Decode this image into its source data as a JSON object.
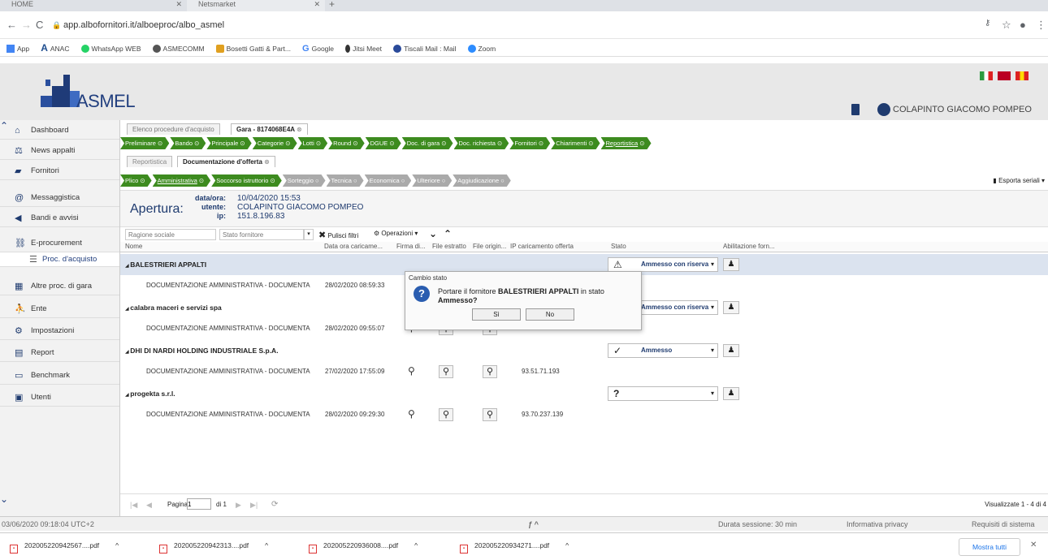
{
  "browser": {
    "tabs": [
      {
        "title": "HOME"
      },
      {
        "title": "Netsmarket"
      }
    ],
    "url": "app.albofornitori.it/alboeproc/albo_asmel",
    "bookmarks": [
      "App",
      "ANAC",
      "WhatsApp WEB",
      "ASMECOMM",
      "Bosetti Gatti & Part...",
      "Google",
      "Jitsi Meet",
      "Tiscali Mail : Mail",
      "Zoom"
    ]
  },
  "header": {
    "logo": "ASMEL",
    "user": "COLAPINTO GIACOMO POMPEO"
  },
  "sidebar": {
    "items": [
      {
        "label": "Dashboard",
        "icon": "home-icon"
      },
      {
        "label": "News appalti",
        "icon": "scale-icon"
      },
      {
        "label": "Fornitori",
        "icon": "truck-icon"
      },
      {
        "label": "Messaggistica",
        "icon": "at-icon"
      },
      {
        "label": "Bandi e avvisi",
        "icon": "megaphone-icon"
      },
      {
        "label": "E-procurement",
        "icon": "link-icon"
      },
      {
        "label": "Proc. d'acquisto",
        "icon": "list-icon"
      },
      {
        "label": "Altre proc. di gara",
        "icon": "building-icon"
      },
      {
        "label": "Ente",
        "icon": "people-icon"
      },
      {
        "label": "Impostazioni",
        "icon": "gear-icon"
      },
      {
        "label": "Report",
        "icon": "chart-icon"
      },
      {
        "label": "Benchmark",
        "icon": "document-icon"
      },
      {
        "label": "Utenti",
        "icon": "user-icon"
      }
    ]
  },
  "tabs": {
    "t1": "Elenco procedure d'acquisto",
    "t2": "Gara - 8174068E4A"
  },
  "steps1": [
    "Preliminare",
    "Bando",
    "Principale",
    "Categorie",
    "Lotti",
    "Round",
    "DGUE",
    "Doc. di gara",
    "Doc. richiesta",
    "Fornitori",
    "Chiarimenti",
    "Reportistica"
  ],
  "subtabs": {
    "t1": "Reportistica",
    "t2": "Documentazione d'offerta"
  },
  "steps2": [
    {
      "label": "Plico",
      "done": true
    },
    {
      "label": "Amministrativa",
      "done": true
    },
    {
      "label": "Soccorso istruttorio",
      "done": true
    },
    {
      "label": "Sorteggio",
      "done": false
    },
    {
      "label": "Tecnica",
      "done": false
    },
    {
      "label": "Economica",
      "done": false
    },
    {
      "label": "Ulteriore",
      "done": false
    },
    {
      "label": "Aggiudicazione",
      "done": false
    }
  ],
  "export_label": "Esporta seriali",
  "apertura": {
    "title": "Apertura:",
    "k1": "data/ora:",
    "v1": "10/04/2020 15:53",
    "k2": "utente:",
    "v2": "COLAPINTO GIACOMO POMPEO",
    "k3": "ip:",
    "v3": "151.8.196.83"
  },
  "filters": {
    "ragione": "Ragione sociale",
    "stato": "Stato fornitore",
    "pulisci": "Pulisci filtri",
    "operazioni": "Operazioni"
  },
  "columns": {
    "nome": "Nome",
    "data": "Data ora caricame...",
    "firma": "Firma di...",
    "estratto": "File estratto",
    "origin": "File origin...",
    "ip": "IP caricamento offerta",
    "stato": "Stato",
    "abil": "Abilitazione forn..."
  },
  "rows": [
    {
      "group": "BALESTRIERI APPALTI",
      "doc": "DOCUMENTAZIONE AMMINISTRATIVA - DOCUMENTA",
      "date": "28/02/2020 08:59:33",
      "ip": "",
      "stato": "Ammesso con riserva",
      "mark": "⚠"
    },
    {
      "group": "calabra maceri e servizi spa",
      "doc": "DOCUMENTAZIONE AMMINISTRATIVA - DOCUMENTA",
      "date": "28/02/2020 09:55:07",
      "ip": "",
      "stato": "Ammesso con riserva",
      "mark": ""
    },
    {
      "group": "DHI DI NARDI HOLDING INDUSTRIALE S.p.A.",
      "doc": "DOCUMENTAZIONE AMMINISTRATIVA - DOCUMENTA",
      "date": "27/02/2020 17:55:09",
      "ip": "93.51.71.193",
      "stato": "Ammesso",
      "mark": "✓"
    },
    {
      "group": "progekta s.r.l.",
      "doc": "DOCUMENTAZIONE AMMINISTRATIVA - DOCUMENTA",
      "date": "28/02/2020 09:29:30",
      "ip": "93.70.237.139",
      "stato": "",
      "mark": "?"
    }
  ],
  "dialog": {
    "title": "Cambio stato",
    "msg1": "Portare il fornitore",
    "msg_name": "BALESTRIERI APPALTI",
    "msg2": "in stato",
    "msg_state": "Ammesso?",
    "yes": "Sì",
    "no": "No"
  },
  "pager": {
    "label": "Pagina",
    "page": "1",
    "of": "di 1",
    "visual": "Visualizzate 1 - 4 di 4"
  },
  "footer": {
    "time": "03/06/2020 09:18:04 UTC+2",
    "session": "Durata sessione: 30 min",
    "privacy": "Informativa privacy",
    "req": "Requisiti di sistema"
  },
  "downloads": [
    "202005220942567....pdf",
    "202005220942313....pdf",
    "202005220936008....pdf",
    "202005220934271....pdf"
  ],
  "show_all": "Mostra tutti"
}
